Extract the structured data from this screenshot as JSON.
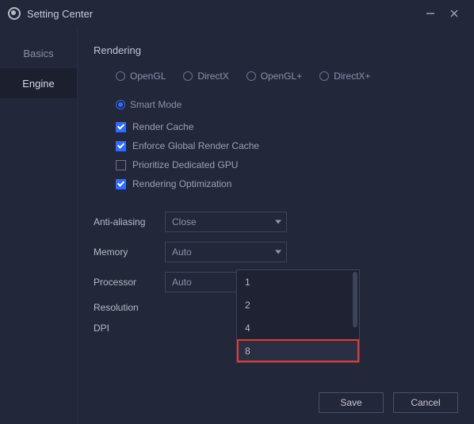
{
  "window": {
    "title": "Setting Center"
  },
  "sidebar": {
    "items": [
      {
        "label": "Basics",
        "active": false
      },
      {
        "label": "Engine",
        "active": true
      }
    ]
  },
  "section": {
    "title": "Rendering"
  },
  "radios": [
    {
      "label": "OpenGL",
      "selected": false
    },
    {
      "label": "DirectX",
      "selected": false
    },
    {
      "label": "OpenGL+",
      "selected": false
    },
    {
      "label": "DirectX+",
      "selected": false
    },
    {
      "label": "Smart Mode",
      "selected": true
    }
  ],
  "checks": [
    {
      "label": "Render Cache",
      "checked": true
    },
    {
      "label": "Enforce Global Render Cache",
      "checked": true
    },
    {
      "label": "Prioritize Dedicated GPU",
      "checked": false
    },
    {
      "label": "Rendering Optimization",
      "checked": true
    }
  ],
  "rows": {
    "antialias": {
      "label": "Anti-aliasing",
      "value": "Close"
    },
    "memory": {
      "label": "Memory",
      "value": "Auto"
    },
    "processor": {
      "label": "Processor",
      "value": "Auto"
    },
    "resolution": {
      "label": "Resolution"
    },
    "dpi": {
      "label": "DPI"
    }
  },
  "dropdown": {
    "options": [
      "1",
      "2",
      "4",
      "8"
    ],
    "highlighted": "8"
  },
  "footer": {
    "save": "Save",
    "cancel": "Cancel"
  }
}
